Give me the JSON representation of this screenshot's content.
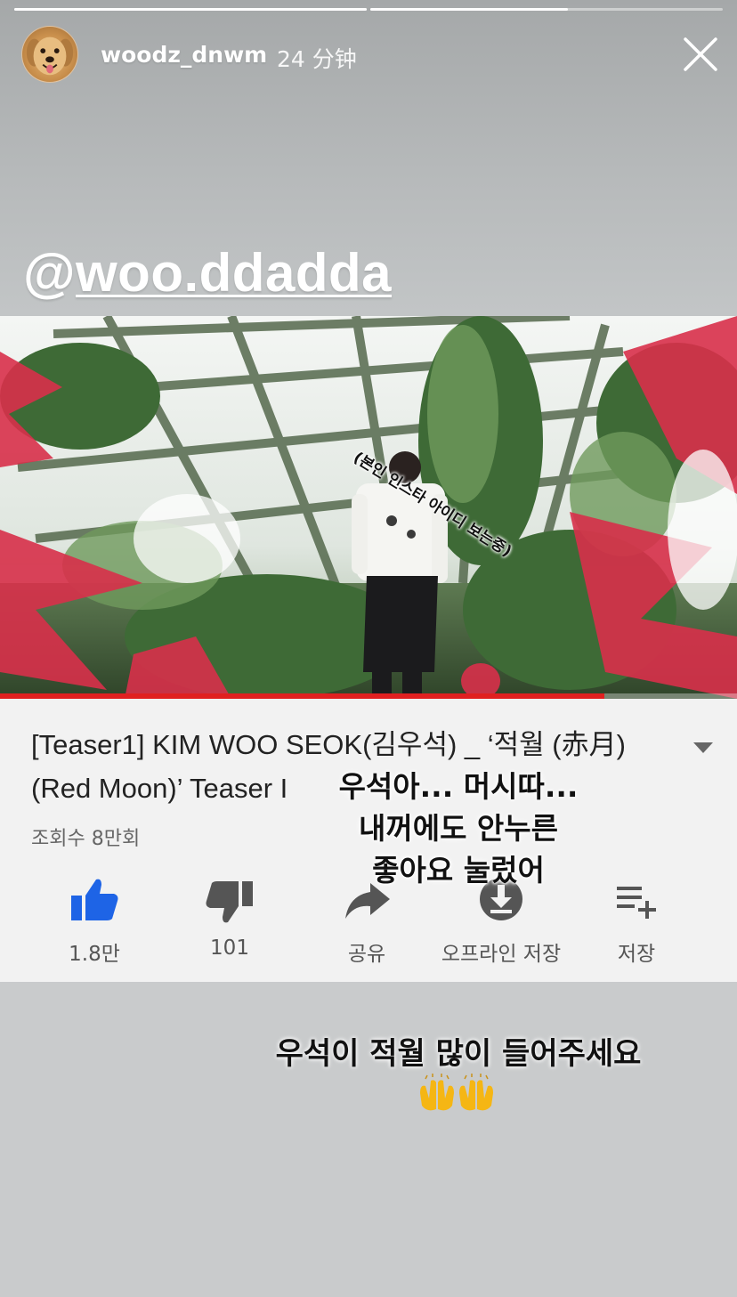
{
  "story": {
    "username": "woodz_dnwm",
    "time_ago": "24 分钟",
    "mention_at": "@",
    "mention_handle": "woo.ddadda",
    "progress": [
      1.0,
      0.56
    ]
  },
  "video": {
    "overlay_sticker": "(본인 인스타 아이디 보는중)",
    "playback_progress": 0.82,
    "title": "[Teaser1] KIM WOO SEOK(김우석) _ ‘적월 (赤月) (Red Moon)’ Teaser I",
    "views": "조회수 8만회"
  },
  "actions": [
    {
      "label": "1.8만",
      "icon": "thumbs-up-icon",
      "color": "#1e64e6"
    },
    {
      "label": "101",
      "icon": "thumbs-down-icon",
      "color": "#555555"
    },
    {
      "label": "공유",
      "icon": "share-icon",
      "color": "#555555"
    },
    {
      "label": "오프라인 저장",
      "icon": "download-icon",
      "color": "#555555"
    },
    {
      "label": "저장",
      "icon": "add-to-playlist-icon",
      "color": "#555555"
    }
  ],
  "captions": {
    "line1": "우석아... 머시따...",
    "line2": "내꺼에도 안누른",
    "line3": "좋아요 눌렀어",
    "bottom": "우석이 적월 많이 들어주세요",
    "emoji": "raising-hands-icon"
  }
}
